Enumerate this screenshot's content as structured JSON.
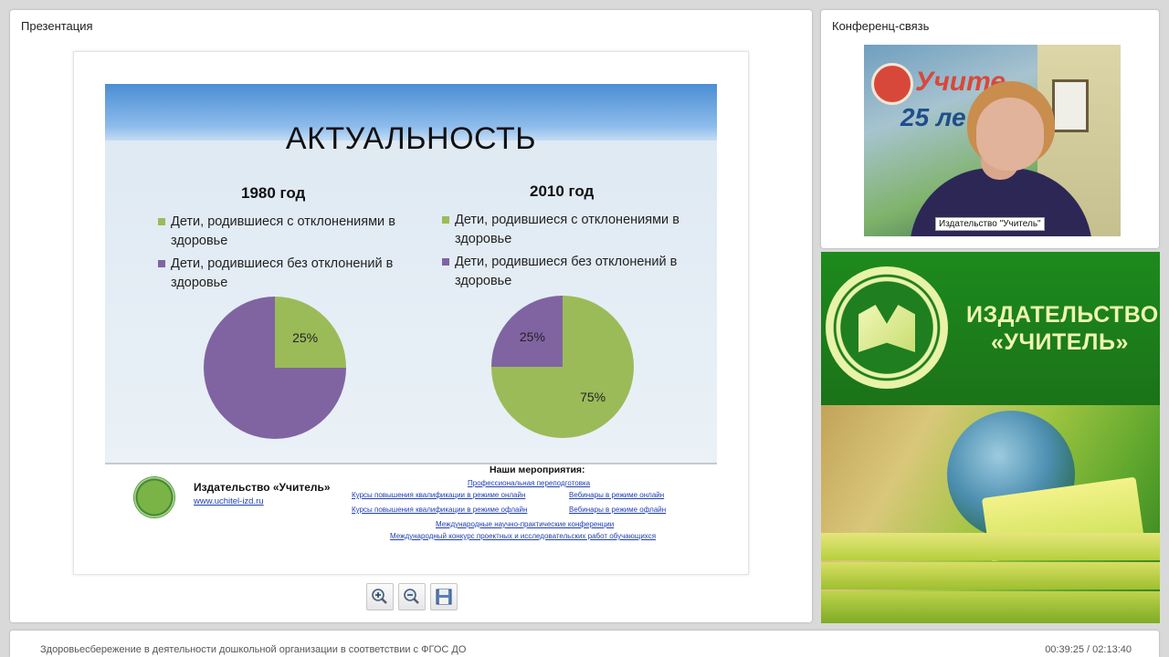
{
  "panels": {
    "presentation_title": "Презентация",
    "conference_title": "Конференц-связь"
  },
  "slide": {
    "title": "АКТУАЛЬНОСТЬ",
    "colors": {
      "green": "#9bbb59",
      "purple": "#8064a2"
    },
    "publisher_name": "Издательство «Учитель»",
    "publisher_url": "www.uchitel-izd.ru",
    "events_heading": "Наши мероприятия:",
    "events": [
      "Профессиональная переподготовка",
      "Курсы повышения квалификации в режиме онлайн",
      "Вебинары в режиме онлайн",
      "Курсы повышения квалификации в режиме офлайн",
      "Вебинары в режиме офлайн",
      "Международные научно-практические конференции",
      "Международный конкурс проектных и исследовательских работ обучающихся"
    ]
  },
  "chart_data": [
    {
      "type": "pie",
      "title": "1980 год",
      "categories": [
        "Дети, родившиеся с отклонениями в здоровье",
        "Дети, родившиеся без отклонений в здоровье"
      ],
      "values": [
        25,
        75
      ],
      "data_labels": [
        "25%",
        ""
      ],
      "colors": [
        "#9bbb59",
        "#8064a2"
      ]
    },
    {
      "type": "pie",
      "title": "2010 год",
      "categories": [
        "Дети, родившиеся с отклонениями в здоровье",
        "Дети, родившиеся без отклонений в здоровье"
      ],
      "values": [
        75,
        25
      ],
      "data_labels": [
        "75%",
        "25%"
      ],
      "colors": [
        "#9bbb59",
        "#8064a2"
      ]
    }
  ],
  "toolbar": {
    "icons": [
      "zoom-in-icon",
      "zoom-out-icon",
      "save-icon"
    ]
  },
  "video": {
    "caption": "Издательство \"Учитель\"",
    "banner_text1": "Учите",
    "banner_text2": "25 ле"
  },
  "ad": {
    "line1": "ИЗДАТЕЛЬСТВО",
    "line2": "«УЧИТЕЛЬ»"
  },
  "footer": {
    "title": "Здоровьесбережение в деятельности дошкольной организации в соответствии с ФГОС ДО",
    "time": "00:39:25 / 02:13:40"
  }
}
